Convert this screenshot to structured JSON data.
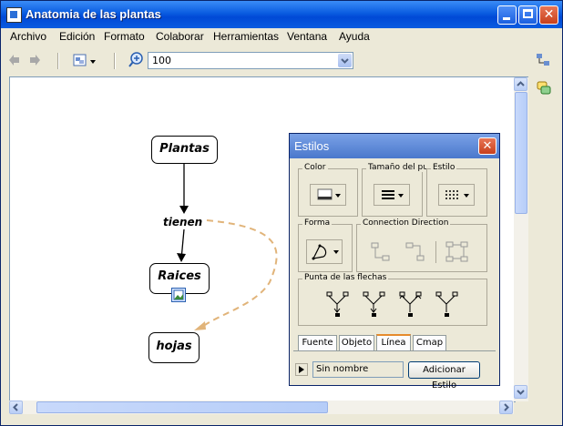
{
  "window": {
    "title": "Anatomia de las plantas"
  },
  "menu": [
    "Archivo",
    "Edición",
    "Formato",
    "Colaborar",
    "Herramientas",
    "Ventana",
    "Ayuda"
  ],
  "toolbar": {
    "zoom_value": "100"
  },
  "map": {
    "nodes": {
      "plantas": "Plantas",
      "raices": "Raices",
      "hojas": "hojas"
    },
    "link_label": "tienen"
  },
  "styles_panel": {
    "title": "Estilos",
    "close_glyph": "✕",
    "groups": {
      "color": "Color",
      "size": "Tamaño del pun",
      "style": "Estilo",
      "shape": "Forma",
      "direction": "Connection Direction",
      "arrowheads": "Punta de las flechas"
    },
    "tabs": [
      "Fuente",
      "Objeto",
      "Línea",
      "Cmap"
    ],
    "active_tab": "Línea",
    "style_name_value": "Sin nombre",
    "add_style_button": "Adicionar Estilo"
  },
  "colors": {
    "accent": "#0a5ce0",
    "dashed_link": "#e1b47a",
    "active_tab": "#e68b2c"
  }
}
